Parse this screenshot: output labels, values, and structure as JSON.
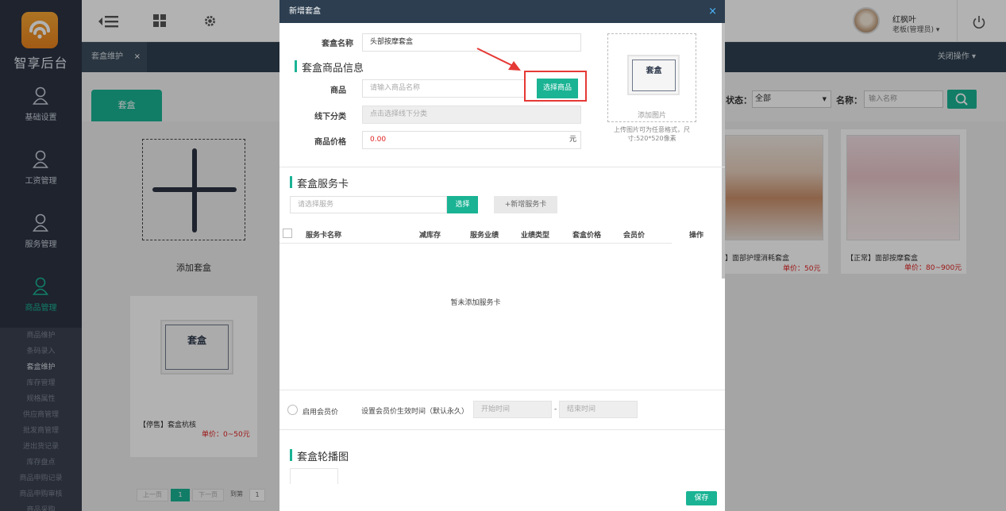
{
  "app": {
    "logo_text": "智享后台"
  },
  "sidebar": {
    "items": [
      {
        "label": "基础设置"
      },
      {
        "label": "工资管理"
      },
      {
        "label": "服务管理"
      },
      {
        "label": "商品管理"
      }
    ],
    "submenu": [
      "商品维护",
      "条码录入",
      "套盒维护",
      "库存管理",
      "规格属性",
      "供应商管理",
      "批发商管理",
      "进出货记录",
      "库存盘点",
      "商品申购记录",
      "商品申购审核",
      "商品采购"
    ]
  },
  "topbar": {
    "user_name": "红枫叶",
    "user_role": "老板(管理员) ▾"
  },
  "tabs": {
    "current": "套盒维护",
    "close_ops": "关闭操作 ▾"
  },
  "main": {
    "tab_label": "套盒",
    "add_label": "添加套盒",
    "filter": {
      "status_label": "状态：",
      "status_value": "全部",
      "name_label": "名称：",
      "name_placeholder": "输入名称"
    },
    "cards": [
      {
        "name": "【停售】套盒杭核",
        "price": "单价：0~50元",
        "logo": "套盒"
      },
      {
        "name": "】面部护理消耗套盒",
        "price": "单价：50元"
      },
      {
        "name": "【正常】面部按摩套盒",
        "price": "单价：80~900元"
      }
    ],
    "pager": {
      "prev": "上一页",
      "page": "1",
      "next": "下一页",
      "goto": "到第",
      "goto_page": "1"
    }
  },
  "modal": {
    "title": "新增套盒",
    "close": "×",
    "name_label": "套盒名称",
    "name_value": "头部按摩套盒",
    "goods_section": "套盒商品信息",
    "goods_label": "商品",
    "goods_placeholder": "请输入商品名称",
    "select_goods_btn": "选择商品",
    "offline_label": "线下分类",
    "offline_placeholder": "点击选择线下分类",
    "price_label": "商品价格",
    "price_value": "0.00",
    "price_unit": "元",
    "upload_logo": "套盒",
    "upload_label": "添加图片",
    "upload_note": "上传图片可为任意格式，尺寸:520*520像素",
    "card_section": "套盒服务卡",
    "service_placeholder": "请选择服务",
    "select_btn": "选择",
    "new_card_btn": "+新增服务卡",
    "columns": [
      "服务卡名称",
      "减库存",
      "服务业绩",
      "业绩类型",
      "套盒价格",
      "会员价",
      "操作"
    ],
    "empty_msg": "暂未添加服务卡",
    "member_price_label": "启用会员价",
    "member_time_label": "设置会员价生效时间（默认永久）",
    "start_placeholder": "开始时间",
    "dash": "-",
    "end_placeholder": "结束时间",
    "carousel_section": "套盒轮播图",
    "save_btn": "保存"
  },
  "colors": {
    "accent": "#1ab394",
    "sidebar": "#2b3342",
    "modal_header": "#2c3e50",
    "highlight": "#e53935",
    "price": "#e02020"
  }
}
